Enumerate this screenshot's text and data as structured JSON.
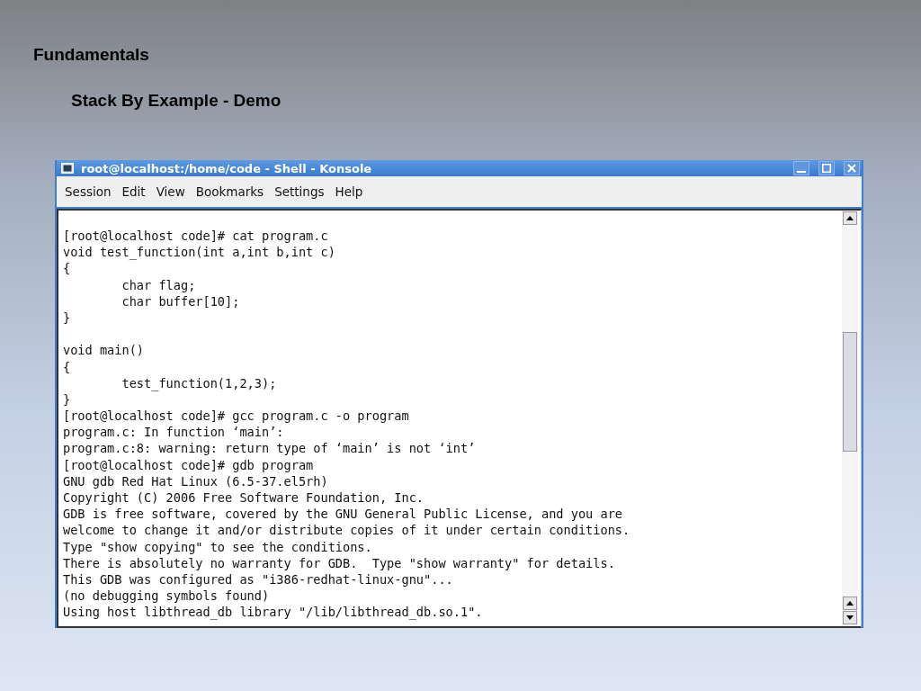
{
  "slide": {
    "title": "Fundamentals",
    "subtitle": "Stack By Example - Demo"
  },
  "window": {
    "title": "root@localhost:/home/code - Shell - Konsole"
  },
  "menu": [
    "Session",
    "Edit",
    "View",
    "Bookmarks",
    "Settings",
    "Help"
  ],
  "terminal": {
    "blocks": [
      [
        "[root@localhost code]# cat program.c",
        "void test_function(int a,int b,int c)",
        "{",
        "        char flag;",
        "        char buffer[10];",
        "}"
      ],
      [
        "void main()",
        "{",
        "        test_function(1,2,3);",
        "}",
        "[root@localhost code]# gcc program.c -o program",
        "program.c: In function ‘main’:",
        "program.c:8: warning: return type of ‘main’ is not ‘int’",
        "[root@localhost code]# gdb program",
        "GNU gdb Red Hat Linux (6.5-37.el5rh)",
        "Copyright (C) 2006 Free Software Foundation, Inc.",
        "GDB is free software, covered by the GNU General Public License, and you are",
        "welcome to change it and/or distribute copies of it under certain conditions.",
        "Type \"show copying\" to see the conditions.",
        "There is absolutely no warranty for GDB.  Type \"show warranty\" for details.",
        "This GDB was configured as \"i386-redhat-linux-gnu\"...",
        "(no debugging symbols found)",
        "Using host libthread_db library \"/lib/libthread_db.so.1\"."
      ]
    ]
  }
}
